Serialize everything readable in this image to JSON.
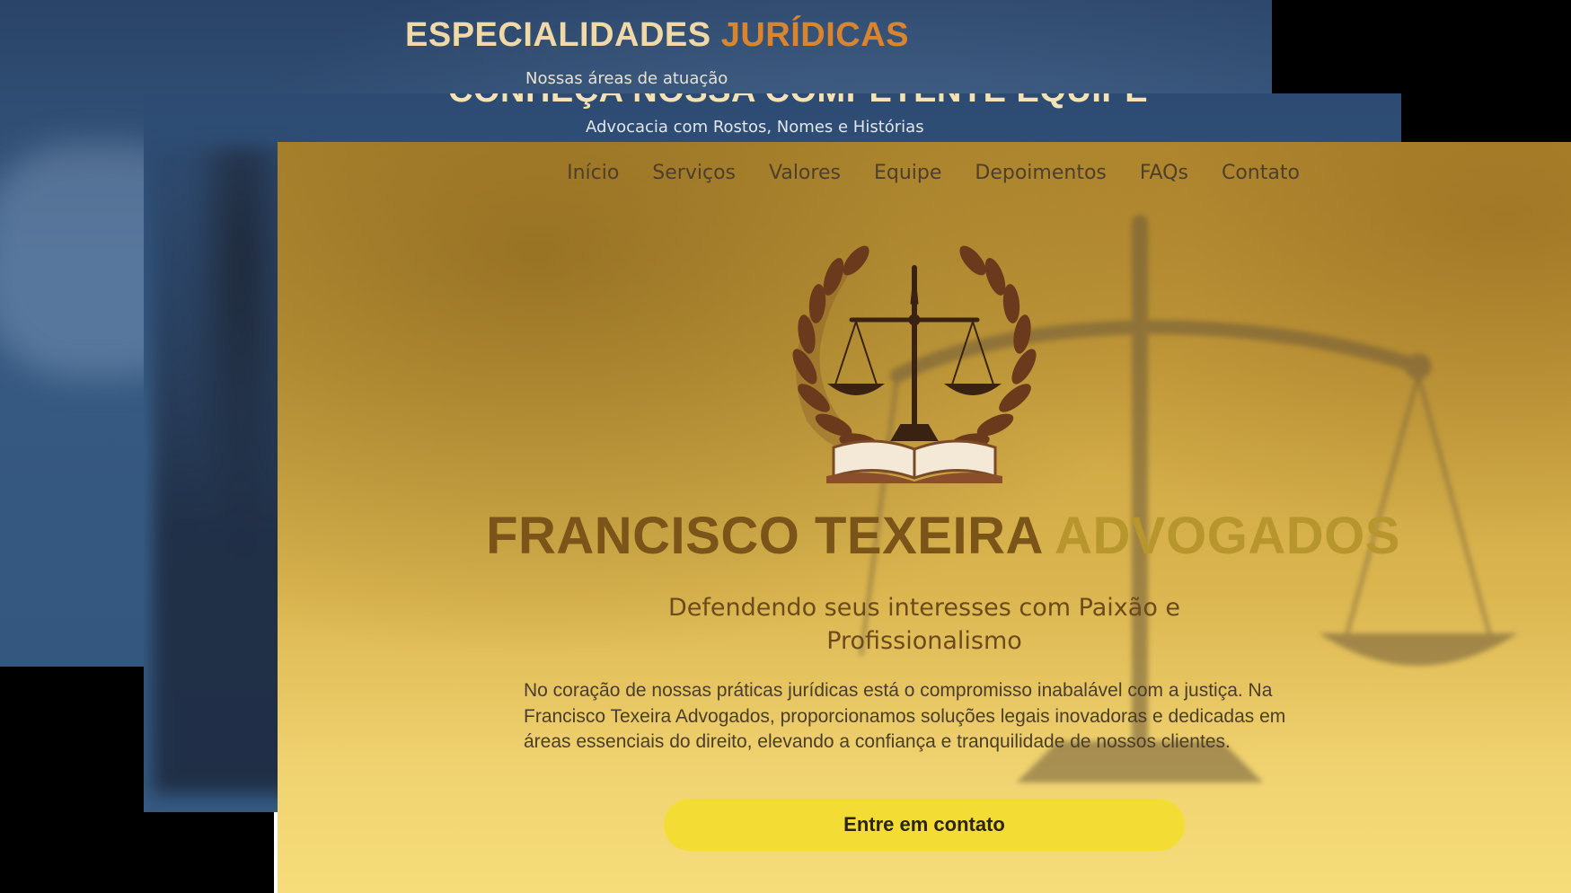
{
  "especialidades": {
    "title_main": "ESPECIALIDADES",
    "title_accent": "JURÍDICAS",
    "subtitle": "Nossas áreas de atuação"
  },
  "equipe": {
    "title": "CONHEÇA NOSSA COMPETENTE EQUIPE",
    "subtitle": "Advocacia com Rostos, Nomes e Histórias"
  },
  "nav": {
    "items": [
      {
        "label": "Início"
      },
      {
        "label": "Serviços"
      },
      {
        "label": "Valores"
      },
      {
        "label": "Equipe"
      },
      {
        "label": "Depoimentos"
      },
      {
        "label": "FAQs"
      },
      {
        "label": "Contato"
      }
    ]
  },
  "hero": {
    "title_main": "FRANCISCO TEXEIRA",
    "title_accent": "ADVOGADOS",
    "tagline": "Defendendo seus interesses com Paixão e Profissionalismo",
    "description": "No coração de nossas práticas jurídicas está o compromisso inabalável com a justiça. Na Francisco Texeira Advogados, proporcionamos soluções legais inovadoras e dedicadas em áreas essenciais do direito, elevando a confiança e tranquilidade de nossos clientes.",
    "cta_label": "Entre em contato"
  },
  "logo": {
    "icon": "scales-of-justice-laurel-book-icon"
  },
  "colors": {
    "gold_accent": "#d9852f",
    "hero_title": "#7a5418",
    "hero_title_accent": "#b8962e",
    "cta_background": "#f3dd35",
    "navy_panel": "#2d4b72"
  }
}
